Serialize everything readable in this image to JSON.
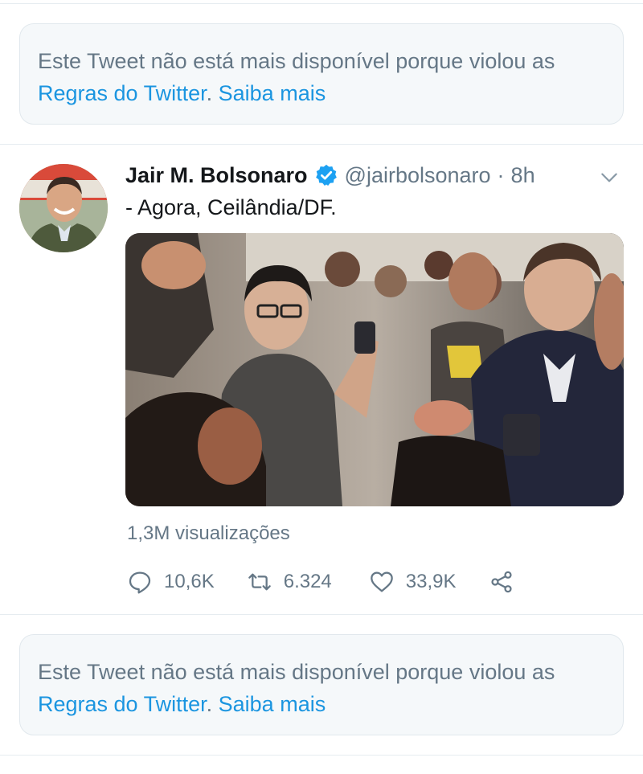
{
  "notices": [
    {
      "text_before": "Este Tweet não está mais disponível porque violou as ",
      "rules_link": "Regras do Twitter",
      "period": ".",
      "learn_more": "Saiba mais"
    },
    {
      "text_before": "Este Tweet não está mais disponível porque violou as ",
      "rules_link": "Regras do Twitter",
      "period": ".",
      "learn_more": "Saiba mais"
    }
  ],
  "tweet": {
    "author_name": "Jair M. Bolsonaro",
    "handle": "@jairbolsonaro",
    "separator": "·",
    "time": "8h",
    "verified": true,
    "text": "- Agora, Ceilândia/DF.",
    "views": "1,3M visualizações",
    "replies": "10,6K",
    "retweets": "6.324",
    "likes": "33,9K"
  },
  "icons": {
    "verified": "verified-badge-icon",
    "more": "chevron-down-icon",
    "reply": "reply-icon",
    "retweet": "retweet-icon",
    "like": "heart-icon",
    "share": "share-icon"
  },
  "colors": {
    "link": "#1b95e0",
    "muted": "#657786",
    "notice_bg": "#f5f8fa"
  }
}
